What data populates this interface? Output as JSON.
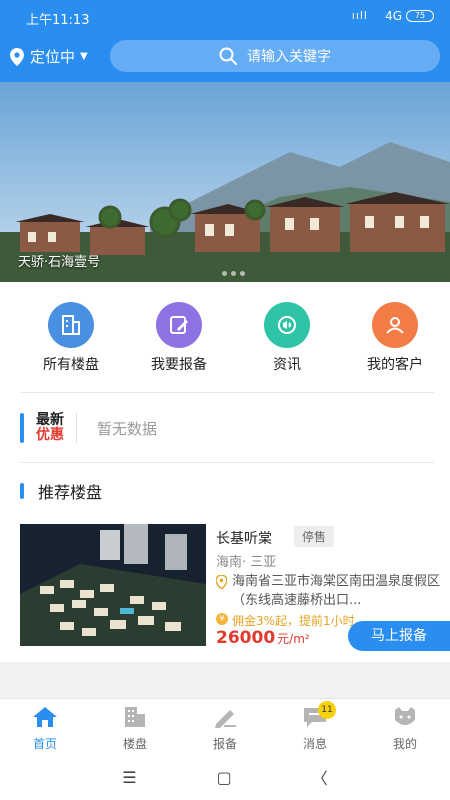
{
  "status_bar": {
    "time": "上午11:13",
    "signal": "ııll",
    "network": "4G",
    "battery": "75"
  },
  "header": {
    "location_label": "定位中",
    "search_placeholder": "请输入关键字"
  },
  "banner": {
    "caption": "天骄·石海壹号",
    "dot_count": 3
  },
  "quick_menu": [
    {
      "label": "所有楼盘",
      "icon": "building-icon",
      "color": "#4a90e2"
    },
    {
      "label": "我要报备",
      "icon": "edit-icon",
      "color": "#8e72e4"
    },
    {
      "label": "资讯",
      "icon": "news-icon",
      "color": "#2ec4a5"
    },
    {
      "label": "我的客户",
      "icon": "users-icon",
      "color": "#f37b46"
    }
  ],
  "promo": {
    "title_line1": "最新",
    "title_line2": "优惠",
    "empty_text": "暂无数据"
  },
  "recommended": {
    "section_title": "推荐楼盘",
    "listing": {
      "name": "长基听棠",
      "status": "停售",
      "region": "海南· 三亚",
      "address": "海南省三亚市海棠区南田温泉度假区（东线高速藤桥出口...",
      "commission": "佣金3%起，提前1小时",
      "price": "26000",
      "price_unit": "元/m²"
    },
    "report_button": "马上报备"
  },
  "tabbar": [
    {
      "label": "首页",
      "icon": "home-icon",
      "active": true
    },
    {
      "label": "楼盘",
      "icon": "buildings-icon",
      "active": false
    },
    {
      "label": "报备",
      "icon": "pencil-icon",
      "active": false
    },
    {
      "label": "消息",
      "icon": "message-icon",
      "active": false,
      "badge": "11"
    },
    {
      "label": "我的",
      "icon": "profile-icon",
      "active": false
    }
  ],
  "system_nav": {
    "menu": "☰",
    "home": "▢",
    "back": "〈"
  },
  "colors": {
    "primary": "#2a8ef0",
    "accent_red": "#e23b2e",
    "commission": "#e5a324"
  }
}
